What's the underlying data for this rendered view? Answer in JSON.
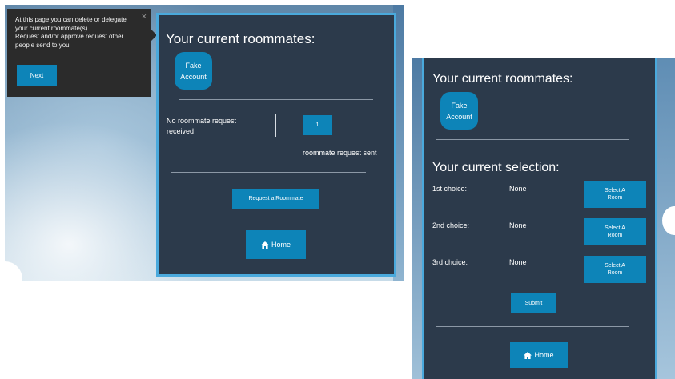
{
  "left_view": {
    "tooltip": {
      "lines": [
        "At this page you can delete or delegate",
        "your current roommate(s).",
        "Request and/or approve request other",
        "people send to you"
      ],
      "close_symbol": "×",
      "next_label": "Next"
    },
    "roommates_title": "Your current roommates:",
    "roommate_name_line1": "Fake",
    "roommate_name_line2": "Account",
    "no_request_line1": "No roommate request",
    "no_request_line2": "received",
    "sent_count": "1",
    "sent_label": "roommate request sent",
    "request_button": "Request a Roommate",
    "home_button": "Home",
    "home_icon": "home-icon"
  },
  "right_view": {
    "roommates_title": "Your current roommates:",
    "roommate_name_line1": "Fake",
    "roommate_name_line2": "Account",
    "selection_title": "Your current selection:",
    "choices": [
      {
        "label": "1st choice:",
        "value": "None",
        "button_line1": "Select A",
        "button_line2": "Room"
      },
      {
        "label": "2nd choice:",
        "value": "None",
        "button_line1": "Select A",
        "button_line2": "Room"
      },
      {
        "label": "3rd choice:",
        "value": "None",
        "button_line1": "Select A",
        "button_line2": "Room"
      }
    ],
    "submit_button": "Submit",
    "home_button": "Home",
    "home_icon": "home-icon"
  },
  "colors": {
    "panel_bg": "#2c3a4b",
    "panel_border": "#4aa9dc",
    "accent_button": "#0d84b8",
    "tooltip_bg": "#2b2b2b"
  }
}
